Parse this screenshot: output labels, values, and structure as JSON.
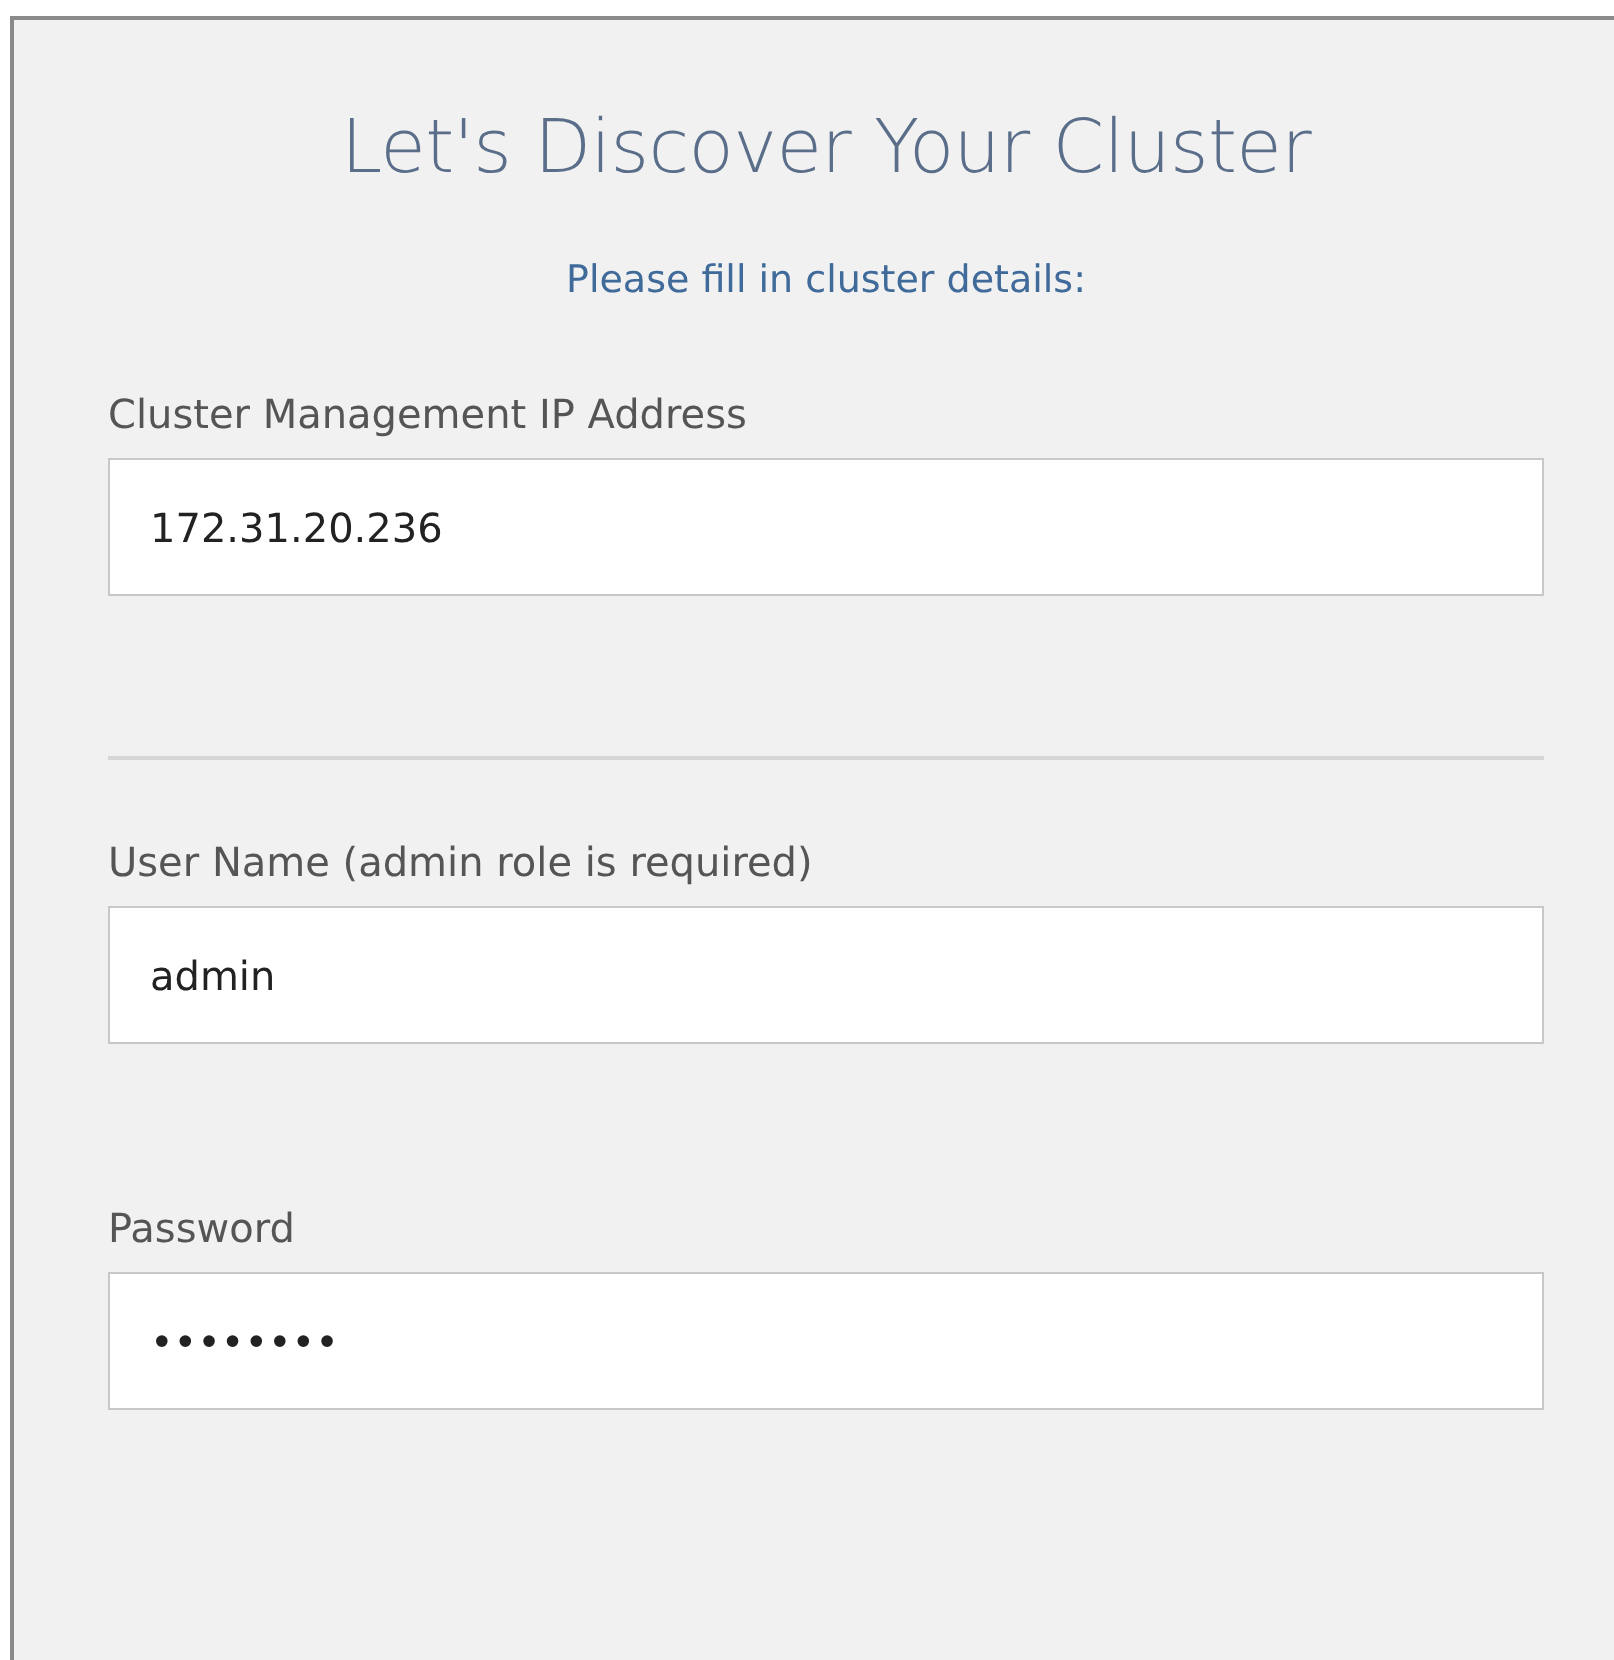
{
  "title": "Let's Discover Your Cluster",
  "subtitle": "Please fill in cluster details:",
  "sections": [
    {
      "fields": [
        {
          "label": "Cluster Management IP Address",
          "value": "172.31.20.236"
        }
      ]
    },
    {
      "fields": [
        {
          "label": "User Name (admin role is required)",
          "value": "admin"
        },
        {
          "label": "Password",
          "value": "••••••••"
        }
      ]
    }
  ]
}
